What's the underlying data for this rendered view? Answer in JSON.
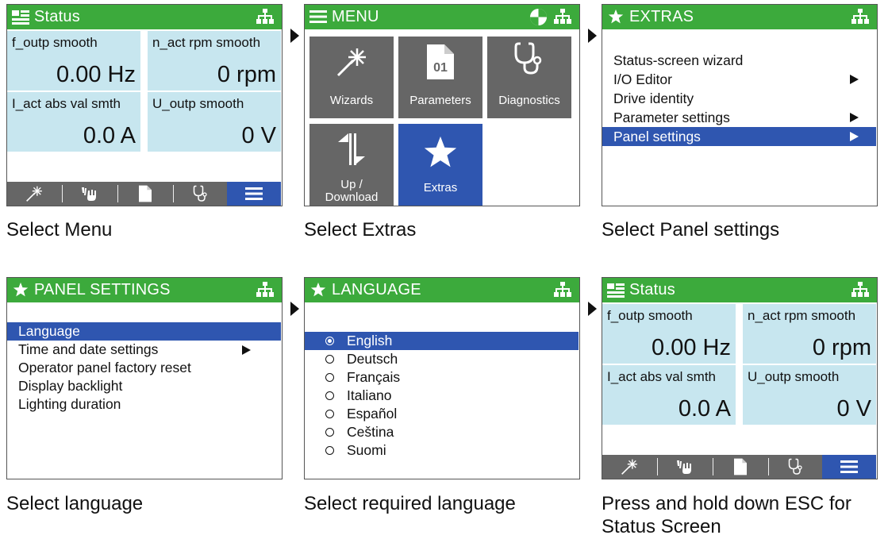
{
  "colors": {
    "header_green": "#3caa3c",
    "selection_blue": "#2f56b0",
    "tile_gray": "#666666",
    "status_cell": "#c7e6ef"
  },
  "status": {
    "title": "Status",
    "cells": [
      {
        "label": "f_outp smooth",
        "value": "0.00 Hz"
      },
      {
        "label": "n_act rpm smooth",
        "value": "0 rpm"
      },
      {
        "label": "I_act abs val smth",
        "value": "0.0 A"
      },
      {
        "label": "U_outp smooth",
        "value": "0 V"
      }
    ],
    "footer_icons": [
      "wizard-wand-icon",
      "hand-icon",
      "parameter-doc-icon",
      "stethoscope-icon",
      "menu-icon"
    ],
    "footer_selected": "menu-icon"
  },
  "menu": {
    "title": "MENU",
    "tiles": [
      {
        "label": "Wizards",
        "icon": "wizard-wand-icon"
      },
      {
        "label": "Parameters",
        "icon": "parameter-doc-icon",
        "icon_text": "01"
      },
      {
        "label": "Diagnostics",
        "icon": "stethoscope-icon"
      },
      {
        "label_line1": "Up /",
        "label_line2": "Download",
        "icon": "up-download-icon"
      },
      {
        "label": "Extras",
        "icon": "star-icon",
        "selected": true
      }
    ]
  },
  "extras": {
    "title": "EXTRAS",
    "items": [
      {
        "label": "Status-screen wizard"
      },
      {
        "label": "I/O Editor",
        "submenu": true
      },
      {
        "label": "Drive identity"
      },
      {
        "label": "Parameter settings",
        "submenu": true
      },
      {
        "label": "Panel settings",
        "submenu": true,
        "selected": true
      }
    ]
  },
  "panel_settings": {
    "title": "PANEL SETTINGS",
    "items": [
      {
        "label": "Language",
        "selected": true
      },
      {
        "label": "Time and date settings",
        "submenu": true
      },
      {
        "label": "Operator panel factory reset"
      },
      {
        "label": "Display backlight"
      },
      {
        "label": "Lighting duration"
      }
    ]
  },
  "language": {
    "title": "LANGUAGE",
    "items": [
      {
        "label": "English",
        "selected": true
      },
      {
        "label": "Deutsch"
      },
      {
        "label": "Français"
      },
      {
        "label": "Italiano"
      },
      {
        "label": "Español"
      },
      {
        "label": "Ceština"
      },
      {
        "label": "Suomi"
      }
    ]
  },
  "captions": {
    "step1": "Select Menu",
    "step2": "Select Extras",
    "step3": "Select Panel settings",
    "step4": "Select language",
    "step5": "Select required language",
    "step6_line1": "Press and hold down ESC for",
    "step6_line2": "Status Screen"
  }
}
